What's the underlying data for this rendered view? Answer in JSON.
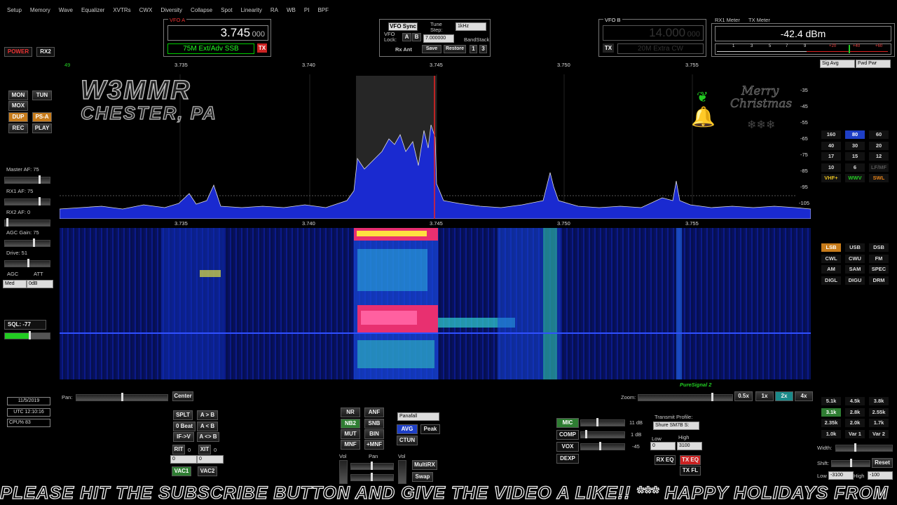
{
  "menu": [
    "Setup",
    "Memory",
    "Wave",
    "Equalizer",
    "XVTRs",
    "CWX",
    "Diversity",
    "Collapse",
    "Spot",
    "Linearity",
    "RA",
    "WB",
    "PI",
    "BPF"
  ],
  "power_label": "POWER",
  "rx2_label": "RX2",
  "vfo_a": {
    "label": "VFO A",
    "freq": "3.745",
    "freq_sub": "000",
    "band": "75M Ext/Adv SSB",
    "tx": "TX"
  },
  "vfo_b": {
    "label": "VFO B",
    "freq": "14.000",
    "freq_sub": "000",
    "band": "20M Extra CW",
    "tx": "TX"
  },
  "sync": {
    "vfo_sync": "VFO Sync",
    "tune_step": "Tune Step:",
    "step_value": "1kHz",
    "vfo_lock": "VFO Lock:",
    "a": "A",
    "b": "B",
    "step_freq": "7.000000",
    "bandstack": "BandStack",
    "rx_ant": "Rx Ant",
    "save": "Save",
    "restore": "Restore",
    "n1": "1",
    "n2": "3"
  },
  "meters": {
    "rx1": "RX1 Meter",
    "tx": "TX Meter",
    "reading": "-42.4 dBm",
    "scale": [
      "1",
      "3",
      "5",
      "7",
      "9",
      "+20",
      "+40",
      "+60"
    ],
    "sig_avg": "Sig Avg",
    "fwd_pwr": "Fwd Pwr"
  },
  "watermark": {
    "line1": "W3MMR",
    "line2": "CHESTER, PA"
  },
  "christmas": {
    "line1": "Merry",
    "line2": "Christmas"
  },
  "freq_axis": [
    "3.735",
    "3.740",
    "3.745",
    "3.750",
    "3.755"
  ],
  "db_axis": [
    "-35",
    "-45",
    "-55",
    "-65",
    "-75",
    "-85",
    "-95",
    "-105"
  ],
  "corner_tag": "49",
  "left_buttons": {
    "mon": "MON",
    "tun": "TUN",
    "mox": "MOX",
    "dup": "DUP",
    "psa": "PS-A",
    "rec": "REC",
    "play": "PLAY"
  },
  "left_sliders": {
    "master_af": "Master AF:  75",
    "rx1_af": "RX1 AF:  75",
    "rx2_af": "RX2 AF:  0",
    "agc_gain": "AGC Gain:  75",
    "drive": "Drive:  51",
    "agc": "AGC",
    "att": "ATT",
    "agc_val": "Med",
    "att_val": "0dB",
    "sql": "SQL: -77"
  },
  "status": {
    "date": "11/5/2019",
    "utc": "UTC 12:10:16",
    "cpu": "CPU%  83"
  },
  "bands": [
    [
      "160",
      "80",
      "60"
    ],
    [
      "40",
      "30",
      "20"
    ],
    [
      "17",
      "15",
      "12"
    ],
    [
      "10",
      "6",
      "LF/MF"
    ],
    [
      "VHF+",
      "WWV",
      "SWL"
    ]
  ],
  "modes": [
    [
      "LSB",
      "USB",
      "DSB"
    ],
    [
      "CWL",
      "CWU",
      "FM"
    ],
    [
      "AM",
      "SAM",
      "SPEC"
    ],
    [
      "DIGL",
      "DIGU",
      "DRM"
    ]
  ],
  "filters": [
    [
      "5.1k",
      "4.5k",
      "3.8k"
    ],
    [
      "3.1k",
      "2.8k",
      "2.55k"
    ],
    [
      "2.35k",
      "2.0k",
      "1.7k"
    ],
    [
      "1.0k",
      "Var 1",
      "Var 2"
    ]
  ],
  "filter_ctrl": {
    "width": "Width:",
    "shift": "Shift:",
    "reset": "Reset",
    "low": "Low",
    "high": "High",
    "low_val": "-3100",
    "high_val": "-100"
  },
  "pan": {
    "pan": "Pan:",
    "center": "Center",
    "zoom": "Zoom:",
    "z05": "0.5x",
    "z1": "1x",
    "z2": "2x",
    "z4": "4x",
    "puresignal": "PureSignal 2"
  },
  "vfo_ops": {
    "splt": "SPLT",
    "ab": "A > B",
    "zero_beat": "0 Beat",
    "ba": "A < B",
    "ifv": "IF->V",
    "swap": "A <> B",
    "rit": "RIT",
    "rit_val": "0",
    "xit": "XIT",
    "xit_val": "0",
    "rit_in": "0",
    "xit_in": "0",
    "vac1": "VAC1",
    "vac2": "VAC2"
  },
  "dsp": {
    "nr": "NR",
    "anf": "ANF",
    "nb2": "NB2",
    "snb": "SNB",
    "mut": "MUT",
    "bin": "BIN",
    "mnf": "MNF",
    "pmnf": "+MNF",
    "display": "Panafall",
    "avg": "AVG",
    "peak": "Peak",
    "ctun": "CTUN",
    "vol": "Vol",
    "pan": "Pan",
    "vol2": "Vol",
    "multirx": "MultiRX",
    "swap": "Swap"
  },
  "tx_ctrl": {
    "mic": "MIC",
    "mic_val": "11 dB",
    "comp": "COMP",
    "comp_val": "1 dB",
    "vox": "VOX",
    "vox_val": "-45",
    "dexp": "DEXP",
    "profile": "Transmit Profile:",
    "profile_val": "Shure SM7B S:",
    "low": "Low",
    "high": "High",
    "low_val": "0",
    "high_val": "3100",
    "rx_eq": "RX EQ",
    "tx_eq": "TX EQ",
    "tx_fl": "TX FL"
  },
  "ticker": "PLEASE HIT THE SUBSCRIBE BUTTON AND GIVE THE VIDEO A LIKE!! *** HAPPY HOLIDAYS FROM",
  "colors": {
    "accent_green": "#2e7d32",
    "band_active": "#1e3fc6",
    "mode_active": "#c77b1a",
    "spectrum_fill": "#1a2ad0",
    "waterfall_bg": "#0a0f6b"
  }
}
